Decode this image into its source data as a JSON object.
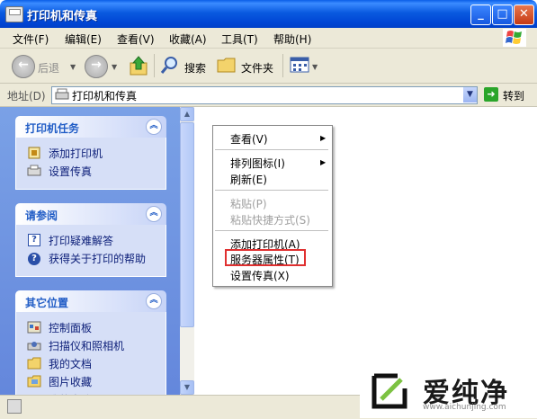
{
  "window": {
    "title": "打印机和传真"
  },
  "menu": [
    "文件(F)",
    "编辑(E)",
    "查看(V)",
    "收藏(A)",
    "工具(T)",
    "帮助(H)"
  ],
  "toolbar": {
    "back": "后退",
    "search": "搜索",
    "folders": "文件夹"
  },
  "address": {
    "label": "地址(D)",
    "value": "打印机和传真",
    "go": "转到"
  },
  "panels": [
    {
      "title": "打印机任务",
      "items": [
        "添加打印机",
        "设置传真"
      ]
    },
    {
      "title": "请参阅",
      "items": [
        "打印疑难解答",
        "获得关于打印的帮助"
      ]
    },
    {
      "title": "其它位置",
      "items": [
        "控制面板",
        "扫描仪和照相机",
        "我的文档",
        "图片收藏",
        "我的电脑"
      ]
    }
  ],
  "context_menu": {
    "items": [
      {
        "label": "查看(V)",
        "submenu": true,
        "enabled": true
      },
      {
        "label": "排列图标(I)",
        "submenu": true,
        "enabled": true
      },
      {
        "label": "刷新(E)",
        "submenu": false,
        "enabled": true
      },
      {
        "label": "粘贴(P)",
        "submenu": false,
        "enabled": false
      },
      {
        "label": "粘贴快捷方式(S)",
        "submenu": false,
        "enabled": false
      },
      {
        "label": "添加打印机(A)",
        "submenu": false,
        "enabled": true
      },
      {
        "label": "服务器属性(T)",
        "submenu": false,
        "enabled": true,
        "highlighted": true
      },
      {
        "label": "设置传真(X)",
        "submenu": false,
        "enabled": true
      }
    ],
    "highlight_color": "#e03030"
  },
  "watermark": {
    "text": "爱纯净",
    "url": "www.aichunjing.com"
  },
  "colors": {
    "titlebar": "#0a5ae0",
    "leftpane": "#6f95e0",
    "panel_title": "#215dc6"
  }
}
